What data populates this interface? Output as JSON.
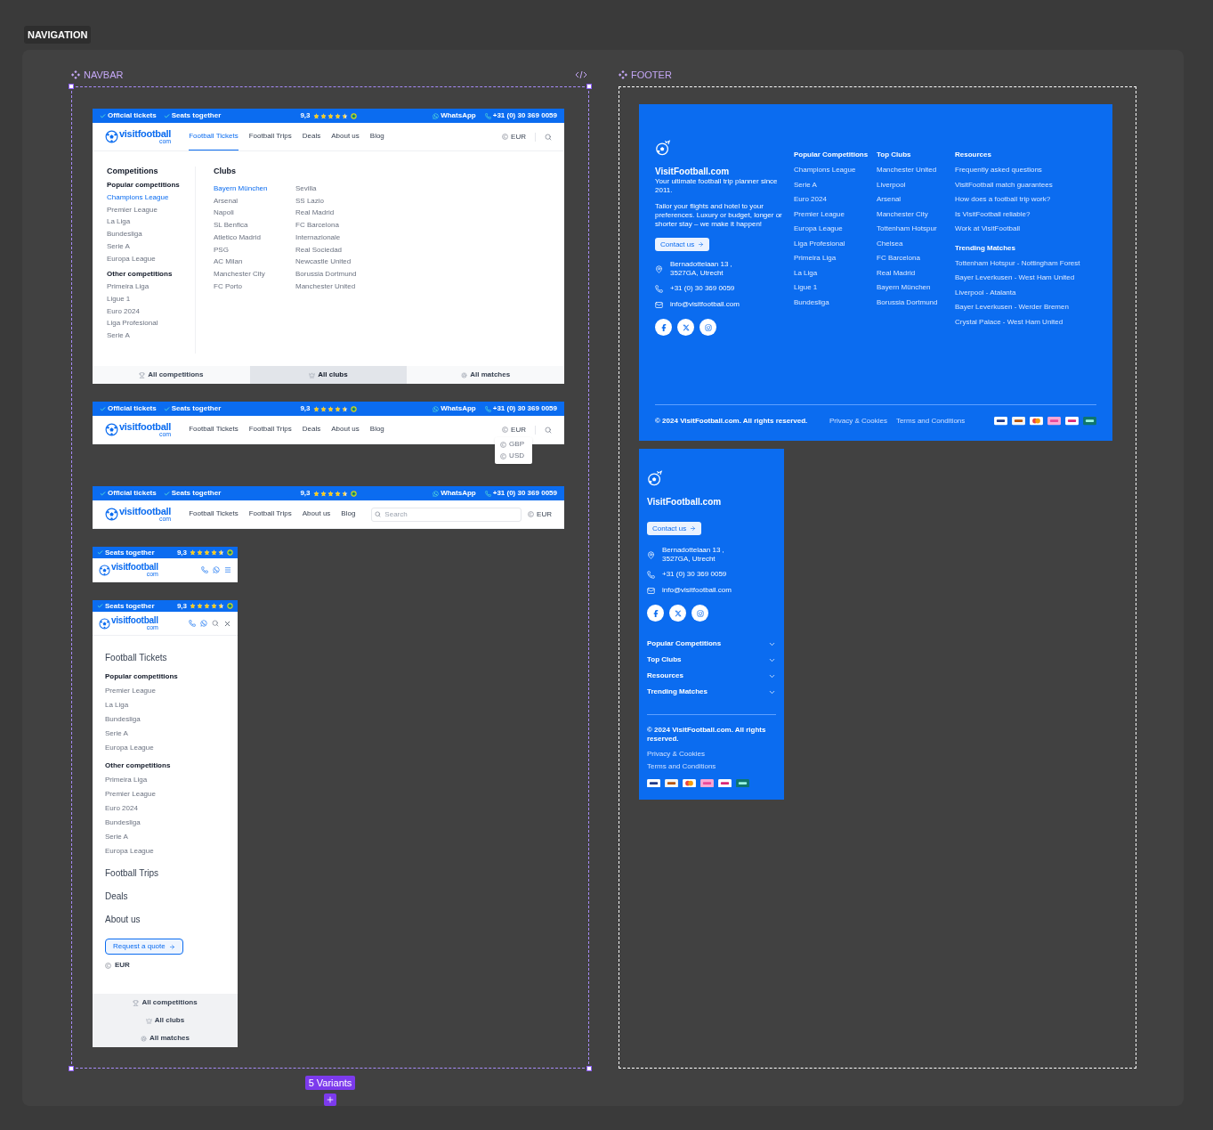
{
  "section_label": "NAVIGATION",
  "navbar": {
    "label": "NAVBAR",
    "variant_count": "5 Variants",
    "variants": [
      {
        "kind": "desktop_menu",
        "top_bar": {
          "badges": [
            "Official tickets",
            "Seats together"
          ],
          "rating": "9,3",
          "stars": 4.5,
          "whatsapp": "WhatsApp",
          "phone": "+31 (0) 30 369 0059"
        },
        "logo": {
          "name": "visitfootball",
          "suffix": "com"
        },
        "links": [
          {
            "label": "Football Tickets",
            "selected": true
          },
          {
            "label": "Football Trips",
            "selected": false
          },
          {
            "label": "Deals",
            "selected": false
          },
          {
            "label": "About us",
            "selected": false
          },
          {
            "label": "Blog",
            "selected": false
          }
        ],
        "currency": "EUR",
        "mega_menu": {
          "competitions": {
            "title": "Competitions",
            "groups": [
              {
                "title": "Popular competitions",
                "items": [
                  {
                    "label": "Champions League",
                    "selected": true
                  },
                  {
                    "label": "Premier League",
                    "selected": false
                  },
                  {
                    "label": "La Liga",
                    "selected": false
                  },
                  {
                    "label": "Bundesliga",
                    "selected": false
                  },
                  {
                    "label": "Serie A",
                    "selected": false
                  },
                  {
                    "label": "Europa League",
                    "selected": false
                  }
                ]
              },
              {
                "title": "Other competitions",
                "items": [
                  {
                    "label": "Primeira Liga",
                    "selected": false
                  },
                  {
                    "label": "Ligue 1",
                    "selected": false
                  },
                  {
                    "label": "Euro 2024",
                    "selected": false
                  },
                  {
                    "label": "Liga Profesional",
                    "selected": false
                  },
                  {
                    "label": "Serie A",
                    "selected": false
                  }
                ]
              }
            ]
          },
          "clubs": {
            "title": "Clubs",
            "columns": [
              {
                "items": [
                  {
                    "label": "Bayern München",
                    "selected": true
                  },
                  {
                    "label": "Arsenal",
                    "selected": false
                  },
                  {
                    "label": "Napoli",
                    "selected": false
                  },
                  {
                    "label": "SL Benfica",
                    "selected": false
                  },
                  {
                    "label": "Atletico Madrid",
                    "selected": false
                  },
                  {
                    "label": "PSG",
                    "selected": false
                  },
                  {
                    "label": "AC Milan",
                    "selected": false
                  },
                  {
                    "label": "Manchester City",
                    "selected": false
                  },
                  {
                    "label": "FC Porto",
                    "selected": false
                  }
                ]
              },
              {
                "items": [
                  {
                    "label": "Sevilla",
                    "selected": false
                  },
                  {
                    "label": "SS Lazio",
                    "selected": false
                  },
                  {
                    "label": "Real Madrid",
                    "selected": false
                  },
                  {
                    "label": "FC Barcelona",
                    "selected": false
                  },
                  {
                    "label": "Internazionale",
                    "selected": false
                  },
                  {
                    "label": "Real Sociedad",
                    "selected": false
                  },
                  {
                    "label": "Newcastle United",
                    "selected": false
                  },
                  {
                    "label": "Borussia Dortmund",
                    "selected": false
                  },
                  {
                    "label": "Manchester United",
                    "selected": false
                  }
                ]
              }
            ]
          }
        },
        "footer_links": [
          {
            "label": "All competitions",
            "selected": false
          },
          {
            "label": "All clubs",
            "selected": true
          },
          {
            "label": "All matches",
            "selected": false
          }
        ]
      },
      {
        "kind": "desktop_currency",
        "top_bar": {
          "badges": [
            "Official tickets",
            "Seats together"
          ],
          "rating": "9,3",
          "stars": 4.5,
          "whatsapp": "WhatsApp",
          "phone": "+31 (0) 30 369 0059"
        },
        "logo": {
          "name": "visitfootball",
          "suffix": "com"
        },
        "links": [
          {
            "label": "Football Tickets",
            "selected": false
          },
          {
            "label": "Football Trips",
            "selected": false
          },
          {
            "label": "Deals",
            "selected": false
          },
          {
            "label": "About us",
            "selected": false
          },
          {
            "label": "Blog",
            "selected": false
          }
        ],
        "currency": "EUR",
        "currency_options": [
          "GBP",
          "USD"
        ]
      },
      {
        "kind": "desktop_search",
        "top_bar": {
          "badges": [
            "Official tickets",
            "Seats together"
          ],
          "rating": "9,3",
          "stars": 4.5,
          "whatsapp": "WhatsApp",
          "phone": "+31 (0) 30 369 0059"
        },
        "logo": {
          "name": "visitfootball",
          "suffix": "com"
        },
        "links": [
          {
            "label": "Football Tickets",
            "selected": false
          },
          {
            "label": "Football Trips",
            "selected": false
          },
          {
            "label": "About us",
            "selected": false
          },
          {
            "label": "Blog",
            "selected": false
          }
        ],
        "search": {
          "placeholder": "Search"
        },
        "currency": "EUR"
      },
      {
        "kind": "mobile",
        "top_bar": {
          "badges": [
            "Seats together"
          ],
          "rating": "9,3",
          "stars": 4.5
        },
        "logo": {
          "name": "visitfootball",
          "suffix": "com"
        }
      },
      {
        "kind": "mobile_menu",
        "top_bar": {
          "badges": [
            "Seats together"
          ],
          "rating": "9,3",
          "stars": 4.5
        },
        "logo": {
          "name": "visitfootball",
          "suffix": "com"
        },
        "menu": {
          "sections": [
            {
              "label": "Football Tickets",
              "groups": [
                {
                  "title": "Popular competitions",
                  "items": [
                    "Premier League",
                    "La Liga",
                    "Bundesliga",
                    "Serie A",
                    "Europa League"
                  ]
                },
                {
                  "title": "Other competitions",
                  "items": [
                    "Primeira Liga",
                    "Premier League",
                    "Euro 2024",
                    "Bundesliga",
                    "Serie A",
                    "Europa League"
                  ]
                }
              ]
            },
            {
              "label": "Football Trips"
            },
            {
              "label": "Deals"
            },
            {
              "label": "About us"
            }
          ],
          "quote_button": "Request a quote",
          "currency": "EUR",
          "footer_links": [
            "All competitions",
            "All clubs",
            "All matches"
          ]
        }
      }
    ]
  },
  "footer": {
    "label": "FOOTER",
    "desktop": {
      "brand": "VisitFootball.com",
      "tagline": "Your ultimate football trip planner since 2011.",
      "description": "Tailor your flights and hotel to your preferences. Luxury or budget, longer or shorter stay – we make it happen!",
      "contact_button": "Contact us",
      "address": [
        "Bernadottelaan 13 ,",
        "3527GA, Utrecht"
      ],
      "phone": "+31 (0) 30 369 0059",
      "email": "info@visitfootball.com",
      "columns": [
        {
          "title": "Popular Competitions",
          "links": [
            "Champions League",
            "Serie A",
            "Euro 2024",
            "Premier League",
            "Europa League",
            "Liga Profesional",
            "Primeira Liga",
            "La Liga",
            "Ligue 1",
            "Bundesliga"
          ]
        },
        {
          "title": "Top Clubs",
          "links": [
            "Manchester United",
            "Liverpool",
            "Arsenal",
            "Manchester City",
            "Tottenham Hotspur",
            "Chelsea",
            "FC Barcelona",
            "Real Madrid",
            "Bayern München",
            "Borussia Dortmund"
          ]
        },
        {
          "title": "Resources",
          "links": [
            "Frequently asked questions",
            "VisitFootball match guarantees",
            "How does a football trip work?",
            "Is VisitFootball reliable?",
            "Work at VisitFootball"
          ]
        },
        {
          "title": "Trending Matches",
          "links": [
            "Tottenham Hotspur - Nottingham Forest",
            "Bayer Leverkusen - West Ham United",
            "Liverpool - Atalanta",
            "Bayer Leverkusen - Werder Bremen",
            "Crystal Palace - West Ham United"
          ]
        }
      ],
      "copyright": "© 2024 VisitFootball.com. All rights reserved.",
      "legal_links": [
        "Privacy & Cookies",
        "Terms and Conditions"
      ]
    },
    "mobile": {
      "brand": "VisitFootball.com",
      "contact_button": "Contact us",
      "address": [
        "Bernadottelaan 13 ,",
        "3527GA, Utrecht"
      ],
      "phone": "+31 (0) 30 369 0059",
      "email": "info@visitfootball.com",
      "accordions": [
        {
          "label": "Popular Competitions",
          "expanded": false
        },
        {
          "label": "Top Clubs",
          "expanded": false
        },
        {
          "label": "Resources",
          "expanded": false
        },
        {
          "label": "Trending Matches",
          "expanded": false
        }
      ],
      "copyright": "© 2024 VisitFootball.com. All rights reserved.",
      "legal_links": [
        "Privacy & Cookies",
        "Terms and Conditions"
      ]
    }
  }
}
